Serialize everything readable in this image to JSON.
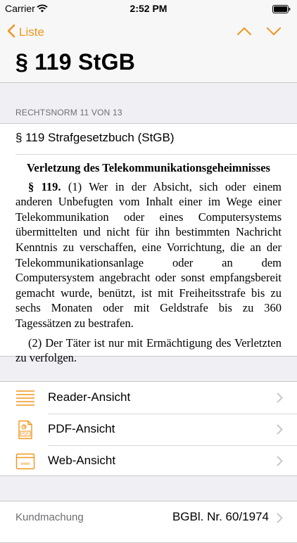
{
  "status_bar": {
    "carrier": "Carrier",
    "time": "2:52 PM"
  },
  "nav": {
    "back_label": "Liste",
    "title": "§ 119 StGB",
    "accent_color": "#f0961e"
  },
  "section": {
    "header": "RECHTSNORM 11 VON 13"
  },
  "law": {
    "heading": "§ 119 Strafgesetzbuch (StGB)",
    "paragraph_title": "Verletzung des Telekommunikationsgeheimnisses",
    "para1_number": "§ 119.",
    "para1_text": "(1) Wer in der Absicht, sich oder einem anderen Unbefugten vom Inhalt einer im Wege einer Telekommunikation oder eines Computersystems übermittelten und nicht für ihn bestimmten Nachricht Kenntnis zu verschaffen, eine Vorrichtung, die an der Telekommunikationsanlage oder an dem Computersystem angebracht oder sonst empfangsbereit gemacht wurde, benützt, ist mit Freiheitsstrafe bis zu sechs Monaten oder mit Geldstrafe bis zu 360 Tagessätzen zu bestrafen.",
    "para2_text": "(2) Der Täter ist nur mit Ermächtigung des Verletzten zu verfolgen."
  },
  "menu": {
    "items": [
      {
        "label": "Reader-Ansicht",
        "icon": "reader-view-icon"
      },
      {
        "label": "PDF-Ansicht",
        "icon": "pdf-file-icon"
      },
      {
        "label": "Web-Ansicht",
        "icon": "web-browser-icon"
      }
    ]
  },
  "info": {
    "label": "Kundmachung",
    "value": "BGBl. Nr. 60/1974"
  }
}
